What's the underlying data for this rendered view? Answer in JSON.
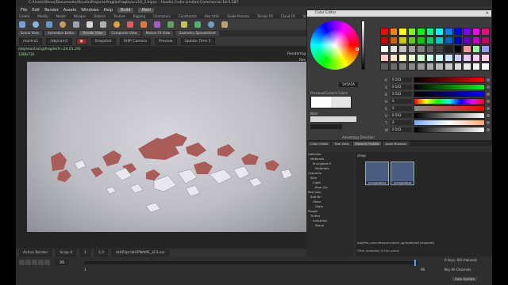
{
  "window": {
    "title": "C:/Users/Steve/Documents/HoudiniProjects/fragile/fragile/scv10_2.hipnc - Houdini Indie Limited-Commercial 18.0.287"
  },
  "menu": {
    "items": [
      "File",
      "Edit",
      "Render",
      "Assets",
      "Windows",
      "Help"
    ],
    "build_label": "Build",
    "main_label": "Main"
  },
  "shelf_tabs": [
    "Create",
    "Modify",
    "Model",
    "Polygon",
    "Deform",
    "Texture",
    "Rigging",
    "Characters",
    "Constraints",
    "Hair Utils",
    "Guide Process",
    "Terrain FX",
    "Cloud FX",
    "Volume"
  ],
  "shelf_tools": [
    "Box",
    "Sphere",
    "Tube",
    "Torus",
    "Grid",
    "Null",
    "Line",
    "Circle",
    "Curve",
    "Draw Curve",
    "Path",
    "Spray Paint",
    "Platonic",
    "L-System",
    "Metaball",
    "File"
  ],
  "panel_tabs": [
    "Scene View",
    "Animation Editor",
    "Render View",
    "Composite View",
    "Motion FX View",
    "Geometry Spreadsheet"
  ],
  "render_toolbar": {
    "renderer": "mantra1",
    "camera": "/obj/cam1",
    "snapshot_label": "Snapshot",
    "camera_field": "SHIP Camera",
    "preview_label": "Preview",
    "update_label": "Update Time 1"
  },
  "viewport": {
    "info_line": "/obj/mantra1@fragile(fr=24.01.29)",
    "res_line": "1280x720",
    "right_tag_top": "Rendering",
    "right_tag_bottom": "Res"
  },
  "viewport_bottom": {
    "active_render": "Active Render",
    "snap": "Snap 4",
    "frame_a": "1",
    "frame_b": "2.2",
    "path": "$HIP/ipr/$HIPNAME_$F4.exr"
  },
  "color_editor": {
    "title": "Color Editor",
    "hex_value": "5A5A5A",
    "previous_current_label": "Previous/Current Colors",
    "note_label": "Note",
    "bottom_label": "Anisotropy Direction",
    "rows": [
      {
        "label": "R",
        "value": "0.543",
        "grad": "linear-gradient(90deg,#000,#f00)"
      },
      {
        "label": "G",
        "value": "0.543",
        "grad": "linear-gradient(90deg,#000,#0f0)"
      },
      {
        "label": "B",
        "value": "0.543",
        "grad": "linear-gradient(90deg,#000,#00f)"
      },
      {
        "label": "H",
        "value": "0",
        "grad": "linear-gradient(90deg,#f00,#ff0,#0f0,#0ff,#00f,#f0f,#f00)"
      },
      {
        "label": "S",
        "value": "0",
        "grad": "linear-gradient(90deg,#8a8a8a,#f00)"
      },
      {
        "label": "V",
        "value": "0.543",
        "grad": "linear-gradient(90deg,#000,#fff)"
      },
      {
        "label": "T",
        "value": "0",
        "grad": "linear-gradient(90deg,#7af,#fff,#fa7)"
      },
      {
        "label": "W",
        "value": "0.543",
        "grad": "linear-gradient(90deg,#000,#fff)"
      }
    ],
    "swatch_colors": [
      "#ff0000",
      "#ff8000",
      "#ffff00",
      "#80ff00",
      "#00ff00",
      "#00ff80",
      "#00ffff",
      "#0080ff",
      "#0000ff",
      "#8000ff",
      "#ff00ff",
      "#ff0080",
      "#cc0000",
      "#cc6600",
      "#cccc00",
      "#66cc00",
      "#00cc00",
      "#00cc66",
      "#00cccc",
      "#0066cc",
      "#0000cc",
      "#6600cc",
      "#cc00cc",
      "#cc0066",
      "#ffffff",
      "#e0e0e0",
      "#c0c0c0",
      "#a0a0a0",
      "#808080",
      "#606060",
      "#404040",
      "#202020",
      "#000000",
      "#ff9999",
      "#99ff99",
      "#9999ff",
      "#ffcccc",
      "#ffe5cc",
      "#ffffcc",
      "#e5ffcc",
      "#ccffcc",
      "#ccffe5",
      "#ccffff",
      "#cce5ff",
      "#ccccff",
      "#e5ccff",
      "#ffccff",
      "#ffcce5",
      "#5a5a5a",
      "#6a6a6a",
      "#7a7a7a",
      "#8a8a8a",
      "#9a9a9a",
      "#aaaaaa",
      "#bababa",
      "#cacaca",
      "#dadada",
      "#eaeaea",
      "#f0f0f0",
      "#f8f8f8"
    ]
  },
  "right_panel": {
    "tabs": [
      "Color Editor",
      "Tree View",
      "Material Palette",
      "Asset Browser"
    ],
    "tree_items": [
      "Galleries",
      "Materials",
      "Encrypted S",
      "Materials",
      "Characte",
      "Skin",
      "Cloth",
      "Blue Clo",
      "Red Velv",
      "Soft Bri",
      "Glass",
      "Glass",
      "Rough",
      "Tinted",
      "Industrial",
      "Stone"
    ],
    "thumbs": [
      "principledshad",
      "principledshad"
    ],
    "bottom_label": "Filter materials in the scene",
    "shop_path": "/obj/fire_concrete/principled_sg/material1(shopnet)",
    "shop_label": "/shop"
  },
  "timeline": {
    "start": "1",
    "end": "96",
    "current": "96",
    "keys_label": "0 keys, 0/0 channels",
    "key_all": "Key All Channels",
    "auto_update": "Auto Update"
  }
}
